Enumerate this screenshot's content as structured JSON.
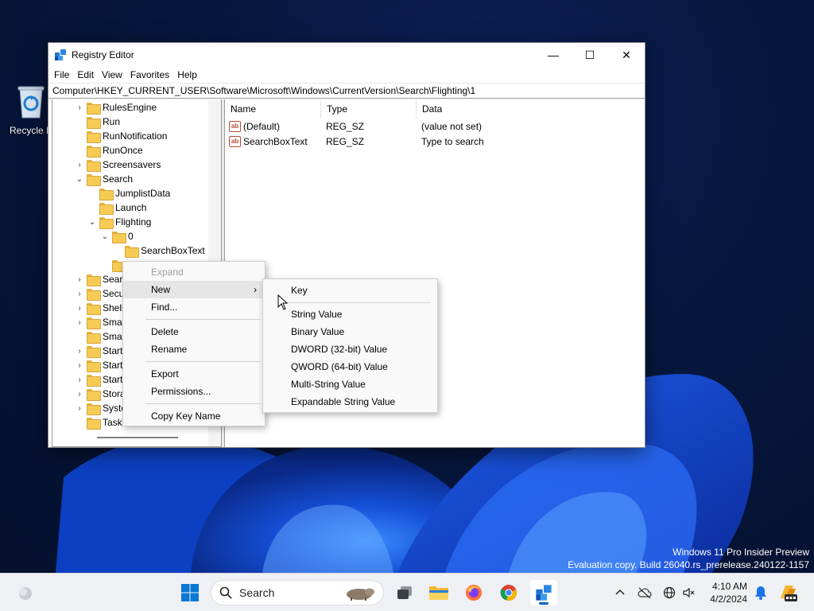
{
  "desktop": {
    "recycle_bin_label": "Recycle B",
    "watermark_line1": "Windows 11 Pro Insider Preview",
    "watermark_line2": "Evaluation copy. Build 26040.rs_prerelease.240122-1157"
  },
  "window": {
    "title": "Registry Editor",
    "controls": {
      "minimize": "—",
      "maximize": "☐",
      "close": "✕"
    },
    "menu": [
      "File",
      "Edit",
      "View",
      "Favorites",
      "Help"
    ],
    "address": "Computer\\HKEY_CURRENT_USER\\Software\\Microsoft\\Windows\\CurrentVersion\\Search\\Flighting\\1"
  },
  "tree": {
    "items": [
      {
        "label": "RulesEngine",
        "chev": "›"
      },
      {
        "label": "Run",
        "chev": ""
      },
      {
        "label": "RunNotification",
        "chev": ""
      },
      {
        "label": "RunOnce",
        "chev": ""
      },
      {
        "label": "Screensavers",
        "chev": "›"
      },
      {
        "label": "Search",
        "chev": "⌄"
      },
      {
        "label": "JumplistData",
        "chev": ""
      },
      {
        "label": "Launch",
        "chev": ""
      },
      {
        "label": "Flighting",
        "chev": "⌄"
      },
      {
        "label": "0",
        "chev": "⌄"
      },
      {
        "label": "SearchBoxText",
        "chev": ""
      },
      {
        "label": "",
        "chev": ""
      },
      {
        "label": "Searc",
        "chev": "›"
      },
      {
        "label": "Secu",
        "chev": "›"
      },
      {
        "label": "Shell",
        "chev": "›"
      },
      {
        "label": "Smar",
        "chev": "›"
      },
      {
        "label": "Smar",
        "chev": ""
      },
      {
        "label": "Start",
        "chev": "›"
      },
      {
        "label": "Startl",
        "chev": "›"
      },
      {
        "label": "Startu",
        "chev": "›"
      },
      {
        "label": "Stora",
        "chev": "›"
      },
      {
        "label": "Syste",
        "chev": "›"
      },
      {
        "label": "Taskl",
        "chev": ""
      }
    ]
  },
  "list": {
    "headers": [
      "Name",
      "Type",
      "Data"
    ],
    "rows": [
      {
        "name": "(Default)",
        "type": "REG_SZ",
        "data": "(value not set)",
        "icon": "ab"
      },
      {
        "name": "SearchBoxText",
        "type": "REG_SZ",
        "data": "Type to search",
        "icon": "ab"
      }
    ]
  },
  "context_menu": {
    "expand": "Expand",
    "new": "New",
    "find": "Find...",
    "delete": "Delete",
    "rename": "Rename",
    "export": "Export",
    "permissions": "Permissions...",
    "copy_key_name": "Copy Key Name",
    "submenu_arrow": "›"
  },
  "new_submenu": {
    "key": "Key",
    "string_value": "String Value",
    "binary_value": "Binary Value",
    "dword_value": "DWORD (32-bit) Value",
    "qword_value": "QWORD (64-bit) Value",
    "multi_string_value": "Multi-String Value",
    "expandable_string_value": "Expandable String Value"
  },
  "taskbar": {
    "search_text": "Search",
    "time": "4:10 AM",
    "date": "4/2/2024",
    "accent": "#0067c0"
  }
}
